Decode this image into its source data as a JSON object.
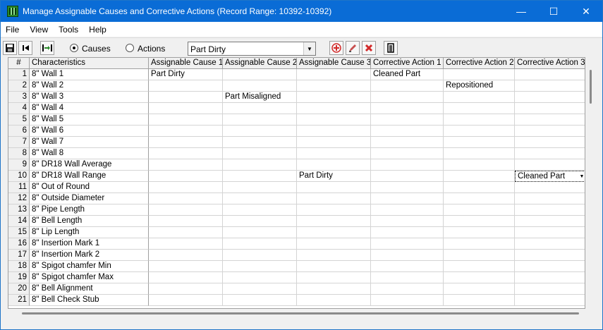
{
  "window": {
    "title": "Manage Assignable Causes and Corrective Actions (Record Range: 10392-10392)",
    "minimize_glyph": "—",
    "maximize_glyph": "☐",
    "close_glyph": "✕"
  },
  "menu": [
    "File",
    "View",
    "Tools",
    "Help"
  ],
  "toolbar": {
    "causes_label": "Causes",
    "actions_label": "Actions",
    "selected_mode": "Causes",
    "dropdown_value": "Part Dirty"
  },
  "grid": {
    "columns": [
      "#",
      "Characteristics",
      "Assignable Cause 1",
      "Assignable Cause 2",
      "Assignable Cause 3",
      "Corrective Action 1",
      "Corrective Action 2",
      "Corrective Action 3"
    ],
    "rows": [
      {
        "n": "1",
        "char": "8\" Wall 1",
        "c1": "Part Dirty",
        "c2": "",
        "c3": "",
        "a1": "Cleaned Part",
        "a2": "",
        "a3": ""
      },
      {
        "n": "2",
        "char": "8\" Wall 2",
        "c1": "",
        "c2": "",
        "c3": "",
        "a1": "",
        "a2": "Repositioned",
        "a3": ""
      },
      {
        "n": "3",
        "char": "8\" Wall 3",
        "c1": "",
        "c2": "Part Misaligned",
        "c3": "",
        "a1": "",
        "a2": "",
        "a3": ""
      },
      {
        "n": "4",
        "char": "8\" Wall 4",
        "c1": "",
        "c2": "",
        "c3": "",
        "a1": "",
        "a2": "",
        "a3": ""
      },
      {
        "n": "5",
        "char": "8\" Wall 5",
        "c1": "",
        "c2": "",
        "c3": "",
        "a1": "",
        "a2": "",
        "a3": ""
      },
      {
        "n": "6",
        "char": "8\" Wall 6",
        "c1": "",
        "c2": "",
        "c3": "",
        "a1": "",
        "a2": "",
        "a3": ""
      },
      {
        "n": "7",
        "char": "8\" Wall 7",
        "c1": "",
        "c2": "",
        "c3": "",
        "a1": "",
        "a2": "",
        "a3": ""
      },
      {
        "n": "8",
        "char": "8\" Wall 8",
        "c1": "",
        "c2": "",
        "c3": "",
        "a1": "",
        "a2": "",
        "a3": ""
      },
      {
        "n": "9",
        "char": "8\" DR18 Wall Average",
        "c1": "",
        "c2": "",
        "c3": "",
        "a1": "",
        "a2": "",
        "a3": ""
      },
      {
        "n": "10",
        "char": "8\" DR18 Wall Range",
        "c1": "",
        "c2": "",
        "c3": "Part Dirty",
        "a1": "",
        "a2": "",
        "a3": "Cleaned Part"
      },
      {
        "n": "11",
        "char": "8\" Out of Round",
        "c1": "",
        "c2": "",
        "c3": "",
        "a1": "",
        "a2": "",
        "a3": ""
      },
      {
        "n": "12",
        "char": "8\" Outside Diameter",
        "c1": "",
        "c2": "",
        "c3": "",
        "a1": "",
        "a2": "",
        "a3": ""
      },
      {
        "n": "13",
        "char": "8\" Pipe Length",
        "c1": "",
        "c2": "",
        "c3": "",
        "a1": "",
        "a2": "",
        "a3": ""
      },
      {
        "n": "14",
        "char": "8\" Bell Length",
        "c1": "",
        "c2": "",
        "c3": "",
        "a1": "",
        "a2": "",
        "a3": ""
      },
      {
        "n": "15",
        "char": "8\" Lip Length",
        "c1": "",
        "c2": "",
        "c3": "",
        "a1": "",
        "a2": "",
        "a3": ""
      },
      {
        "n": "16",
        "char": "8\" Insertion Mark 1",
        "c1": "",
        "c2": "",
        "c3": "",
        "a1": "",
        "a2": "",
        "a3": ""
      },
      {
        "n": "17",
        "char": "8\" Insertion Mark 2",
        "c1": "",
        "c2": "",
        "c3": "",
        "a1": "",
        "a2": "",
        "a3": ""
      },
      {
        "n": "18",
        "char": "8\" Spigot chamfer Min",
        "c1": "",
        "c2": "",
        "c3": "",
        "a1": "",
        "a2": "",
        "a3": ""
      },
      {
        "n": "19",
        "char": "8\" Spigot chamfer Max",
        "c1": "",
        "c2": "",
        "c3": "",
        "a1": "",
        "a2": "",
        "a3": ""
      },
      {
        "n": "20",
        "char": "8\" Bell Alignment",
        "c1": "",
        "c2": "",
        "c3": "",
        "a1": "",
        "a2": "",
        "a3": ""
      },
      {
        "n": "21",
        "char": "8\" Bell Check Stub",
        "c1": "",
        "c2": "",
        "c3": "",
        "a1": "",
        "a2": "",
        "a3": ""
      }
    ]
  },
  "icons": {
    "save": "save-icon",
    "first": "first-record-icon",
    "transfer": "transfer-icon",
    "add": "add-icon",
    "edit": "edit-icon",
    "delete": "delete-icon",
    "exit": "exit-icon"
  },
  "colors": {
    "titlebar": "#0a6cd6",
    "add": "#d22a2a",
    "delete": "#d22a2a"
  }
}
